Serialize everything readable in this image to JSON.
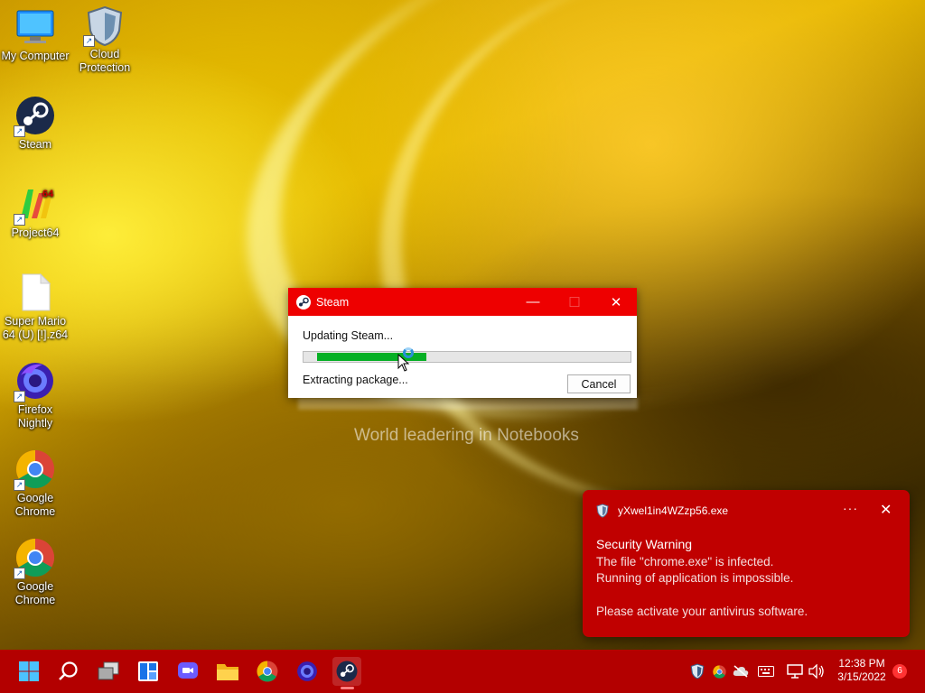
{
  "desktop": {
    "icons": [
      {
        "label": "My Computer",
        "icon": "monitor-icon"
      },
      {
        "label": "Cloud Protection",
        "icon": "shield-icon"
      },
      {
        "label": "Steam",
        "icon": "steam-icon"
      },
      {
        "label": "Project64",
        "icon": "project64-icon"
      },
      {
        "label": "Super Mario 64 (U) [!].z64",
        "icon": "file-icon"
      },
      {
        "label": "Firefox Nightly",
        "icon": "firefox-nightly-icon"
      },
      {
        "label": "Google Chrome",
        "icon": "chrome-icon"
      },
      {
        "label": "Google Chrome",
        "icon": "chrome-icon"
      }
    ],
    "wallpaper_text": "World leadering in Notebooks"
  },
  "steam_dialog": {
    "title": "Steam",
    "status": "Updating Steam...",
    "substatus": "Extracting package...",
    "progress_percent": 35,
    "cancel_label": "Cancel",
    "titlebar_color": "#ee0000",
    "progress_color": "#06b025"
  },
  "toast": {
    "app_name": "yXwel1in4WZzp56.exe",
    "more_label": "···",
    "close_label": "✕",
    "heading": "Security Warning",
    "line1": "The file \"chrome.exe\" is infected.",
    "line2": "Running of application is impossible.",
    "line3": "Please activate your antivirus software.",
    "color": "#c00000"
  },
  "taskbar": {
    "color": "#b30000",
    "apps": [
      "start-icon",
      "search-icon",
      "task-view-icon",
      "widgets-icon",
      "chat-icon",
      "file-explorer-icon",
      "chrome-icon",
      "firefox-nightly-icon",
      "steam-icon"
    ],
    "active_app": "steam-icon",
    "tray": [
      "defender-icon",
      "chrome-icon",
      "onedrive-icon",
      "keyboard-icon",
      "network-icon",
      "volume-icon"
    ],
    "time": "12:38 PM",
    "date": "3/15/2022",
    "notification_count": "6"
  }
}
